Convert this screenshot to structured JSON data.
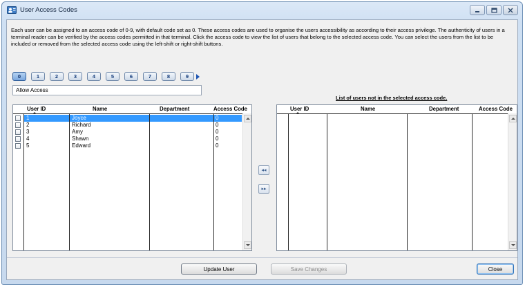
{
  "window": {
    "title": "User Access Codes"
  },
  "description": "Each user can be assigned to an access code of 0-9, with default code set as 0. These access codes are used to organise the users accessibility as according to their access privilege. The authenticity of users in a terminal reader can be verified by the access codes permitted in that terminal. Click the access code to view the list of users that belong to the selected access code. You can select the users from the list to be included or removed from the selected access code using the left-shift or right-shift buttons.",
  "access_codes": [
    "0",
    "1",
    "2",
    "3",
    "4",
    "5",
    "6",
    "7",
    "8",
    "9"
  ],
  "selected_code": "0",
  "code_name": "Allow Access",
  "left_grid": {
    "columns": [
      "User ID",
      "Name",
      "Department",
      "Access Code"
    ],
    "rows": [
      {
        "id": "1",
        "name": "Joyce",
        "dept": "",
        "code": "0",
        "selected": true
      },
      {
        "id": "2",
        "name": "Richard",
        "dept": "",
        "code": "0",
        "selected": false
      },
      {
        "id": "3",
        "name": "Amy",
        "dept": "",
        "code": "0",
        "selected": false
      },
      {
        "id": "4",
        "name": "Shawn",
        "dept": "",
        "code": "0",
        "selected": false
      },
      {
        "id": "5",
        "name": "Edward",
        "dept": "",
        "code": "0",
        "selected": false
      }
    ]
  },
  "right_grid": {
    "title": "List of users not in the selected access code.",
    "columns": [
      "User ID",
      "Name",
      "Department",
      "Access Code"
    ],
    "rows": []
  },
  "shift_buttons": {
    "left": "◂◂",
    "right": "▸▸"
  },
  "buttons": {
    "update_user": "Update User",
    "save_changes": "Save Changes",
    "close": "Close"
  },
  "colors": {
    "selection": "#3399ff",
    "active_code": "#7aa7de"
  }
}
